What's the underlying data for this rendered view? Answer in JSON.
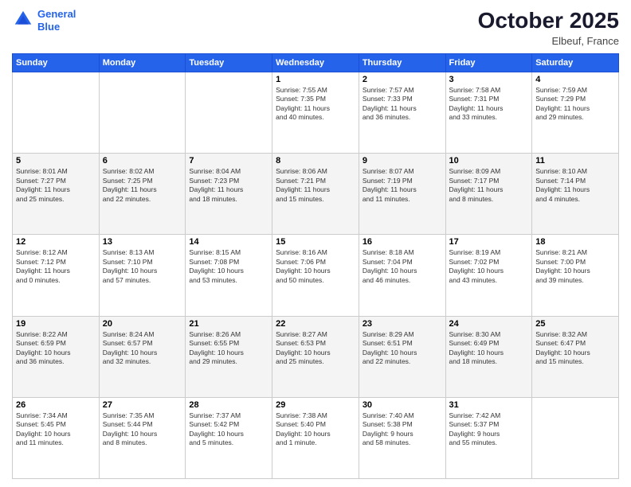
{
  "header": {
    "logo_line1": "General",
    "logo_line2": "Blue",
    "month": "October 2025",
    "location": "Elbeuf, France"
  },
  "weekdays": [
    "Sunday",
    "Monday",
    "Tuesday",
    "Wednesday",
    "Thursday",
    "Friday",
    "Saturday"
  ],
  "weeks": [
    [
      {
        "day": "",
        "info": ""
      },
      {
        "day": "",
        "info": ""
      },
      {
        "day": "",
        "info": ""
      },
      {
        "day": "1",
        "info": "Sunrise: 7:55 AM\nSunset: 7:35 PM\nDaylight: 11 hours\nand 40 minutes."
      },
      {
        "day": "2",
        "info": "Sunrise: 7:57 AM\nSunset: 7:33 PM\nDaylight: 11 hours\nand 36 minutes."
      },
      {
        "day": "3",
        "info": "Sunrise: 7:58 AM\nSunset: 7:31 PM\nDaylight: 11 hours\nand 33 minutes."
      },
      {
        "day": "4",
        "info": "Sunrise: 7:59 AM\nSunset: 7:29 PM\nDaylight: 11 hours\nand 29 minutes."
      }
    ],
    [
      {
        "day": "5",
        "info": "Sunrise: 8:01 AM\nSunset: 7:27 PM\nDaylight: 11 hours\nand 25 minutes."
      },
      {
        "day": "6",
        "info": "Sunrise: 8:02 AM\nSunset: 7:25 PM\nDaylight: 11 hours\nand 22 minutes."
      },
      {
        "day": "7",
        "info": "Sunrise: 8:04 AM\nSunset: 7:23 PM\nDaylight: 11 hours\nand 18 minutes."
      },
      {
        "day": "8",
        "info": "Sunrise: 8:06 AM\nSunset: 7:21 PM\nDaylight: 11 hours\nand 15 minutes."
      },
      {
        "day": "9",
        "info": "Sunrise: 8:07 AM\nSunset: 7:19 PM\nDaylight: 11 hours\nand 11 minutes."
      },
      {
        "day": "10",
        "info": "Sunrise: 8:09 AM\nSunset: 7:17 PM\nDaylight: 11 hours\nand 8 minutes."
      },
      {
        "day": "11",
        "info": "Sunrise: 8:10 AM\nSunset: 7:14 PM\nDaylight: 11 hours\nand 4 minutes."
      }
    ],
    [
      {
        "day": "12",
        "info": "Sunrise: 8:12 AM\nSunset: 7:12 PM\nDaylight: 11 hours\nand 0 minutes."
      },
      {
        "day": "13",
        "info": "Sunrise: 8:13 AM\nSunset: 7:10 PM\nDaylight: 10 hours\nand 57 minutes."
      },
      {
        "day": "14",
        "info": "Sunrise: 8:15 AM\nSunset: 7:08 PM\nDaylight: 10 hours\nand 53 minutes."
      },
      {
        "day": "15",
        "info": "Sunrise: 8:16 AM\nSunset: 7:06 PM\nDaylight: 10 hours\nand 50 minutes."
      },
      {
        "day": "16",
        "info": "Sunrise: 8:18 AM\nSunset: 7:04 PM\nDaylight: 10 hours\nand 46 minutes."
      },
      {
        "day": "17",
        "info": "Sunrise: 8:19 AM\nSunset: 7:02 PM\nDaylight: 10 hours\nand 43 minutes."
      },
      {
        "day": "18",
        "info": "Sunrise: 8:21 AM\nSunset: 7:00 PM\nDaylight: 10 hours\nand 39 minutes."
      }
    ],
    [
      {
        "day": "19",
        "info": "Sunrise: 8:22 AM\nSunset: 6:59 PM\nDaylight: 10 hours\nand 36 minutes."
      },
      {
        "day": "20",
        "info": "Sunrise: 8:24 AM\nSunset: 6:57 PM\nDaylight: 10 hours\nand 32 minutes."
      },
      {
        "day": "21",
        "info": "Sunrise: 8:26 AM\nSunset: 6:55 PM\nDaylight: 10 hours\nand 29 minutes."
      },
      {
        "day": "22",
        "info": "Sunrise: 8:27 AM\nSunset: 6:53 PM\nDaylight: 10 hours\nand 25 minutes."
      },
      {
        "day": "23",
        "info": "Sunrise: 8:29 AM\nSunset: 6:51 PM\nDaylight: 10 hours\nand 22 minutes."
      },
      {
        "day": "24",
        "info": "Sunrise: 8:30 AM\nSunset: 6:49 PM\nDaylight: 10 hours\nand 18 minutes."
      },
      {
        "day": "25",
        "info": "Sunrise: 8:32 AM\nSunset: 6:47 PM\nDaylight: 10 hours\nand 15 minutes."
      }
    ],
    [
      {
        "day": "26",
        "info": "Sunrise: 7:34 AM\nSunset: 5:45 PM\nDaylight: 10 hours\nand 11 minutes."
      },
      {
        "day": "27",
        "info": "Sunrise: 7:35 AM\nSunset: 5:44 PM\nDaylight: 10 hours\nand 8 minutes."
      },
      {
        "day": "28",
        "info": "Sunrise: 7:37 AM\nSunset: 5:42 PM\nDaylight: 10 hours\nand 5 minutes."
      },
      {
        "day": "29",
        "info": "Sunrise: 7:38 AM\nSunset: 5:40 PM\nDaylight: 10 hours\nand 1 minute."
      },
      {
        "day": "30",
        "info": "Sunrise: 7:40 AM\nSunset: 5:38 PM\nDaylight: 9 hours\nand 58 minutes."
      },
      {
        "day": "31",
        "info": "Sunrise: 7:42 AM\nSunset: 5:37 PM\nDaylight: 9 hours\nand 55 minutes."
      },
      {
        "day": "",
        "info": ""
      }
    ]
  ]
}
